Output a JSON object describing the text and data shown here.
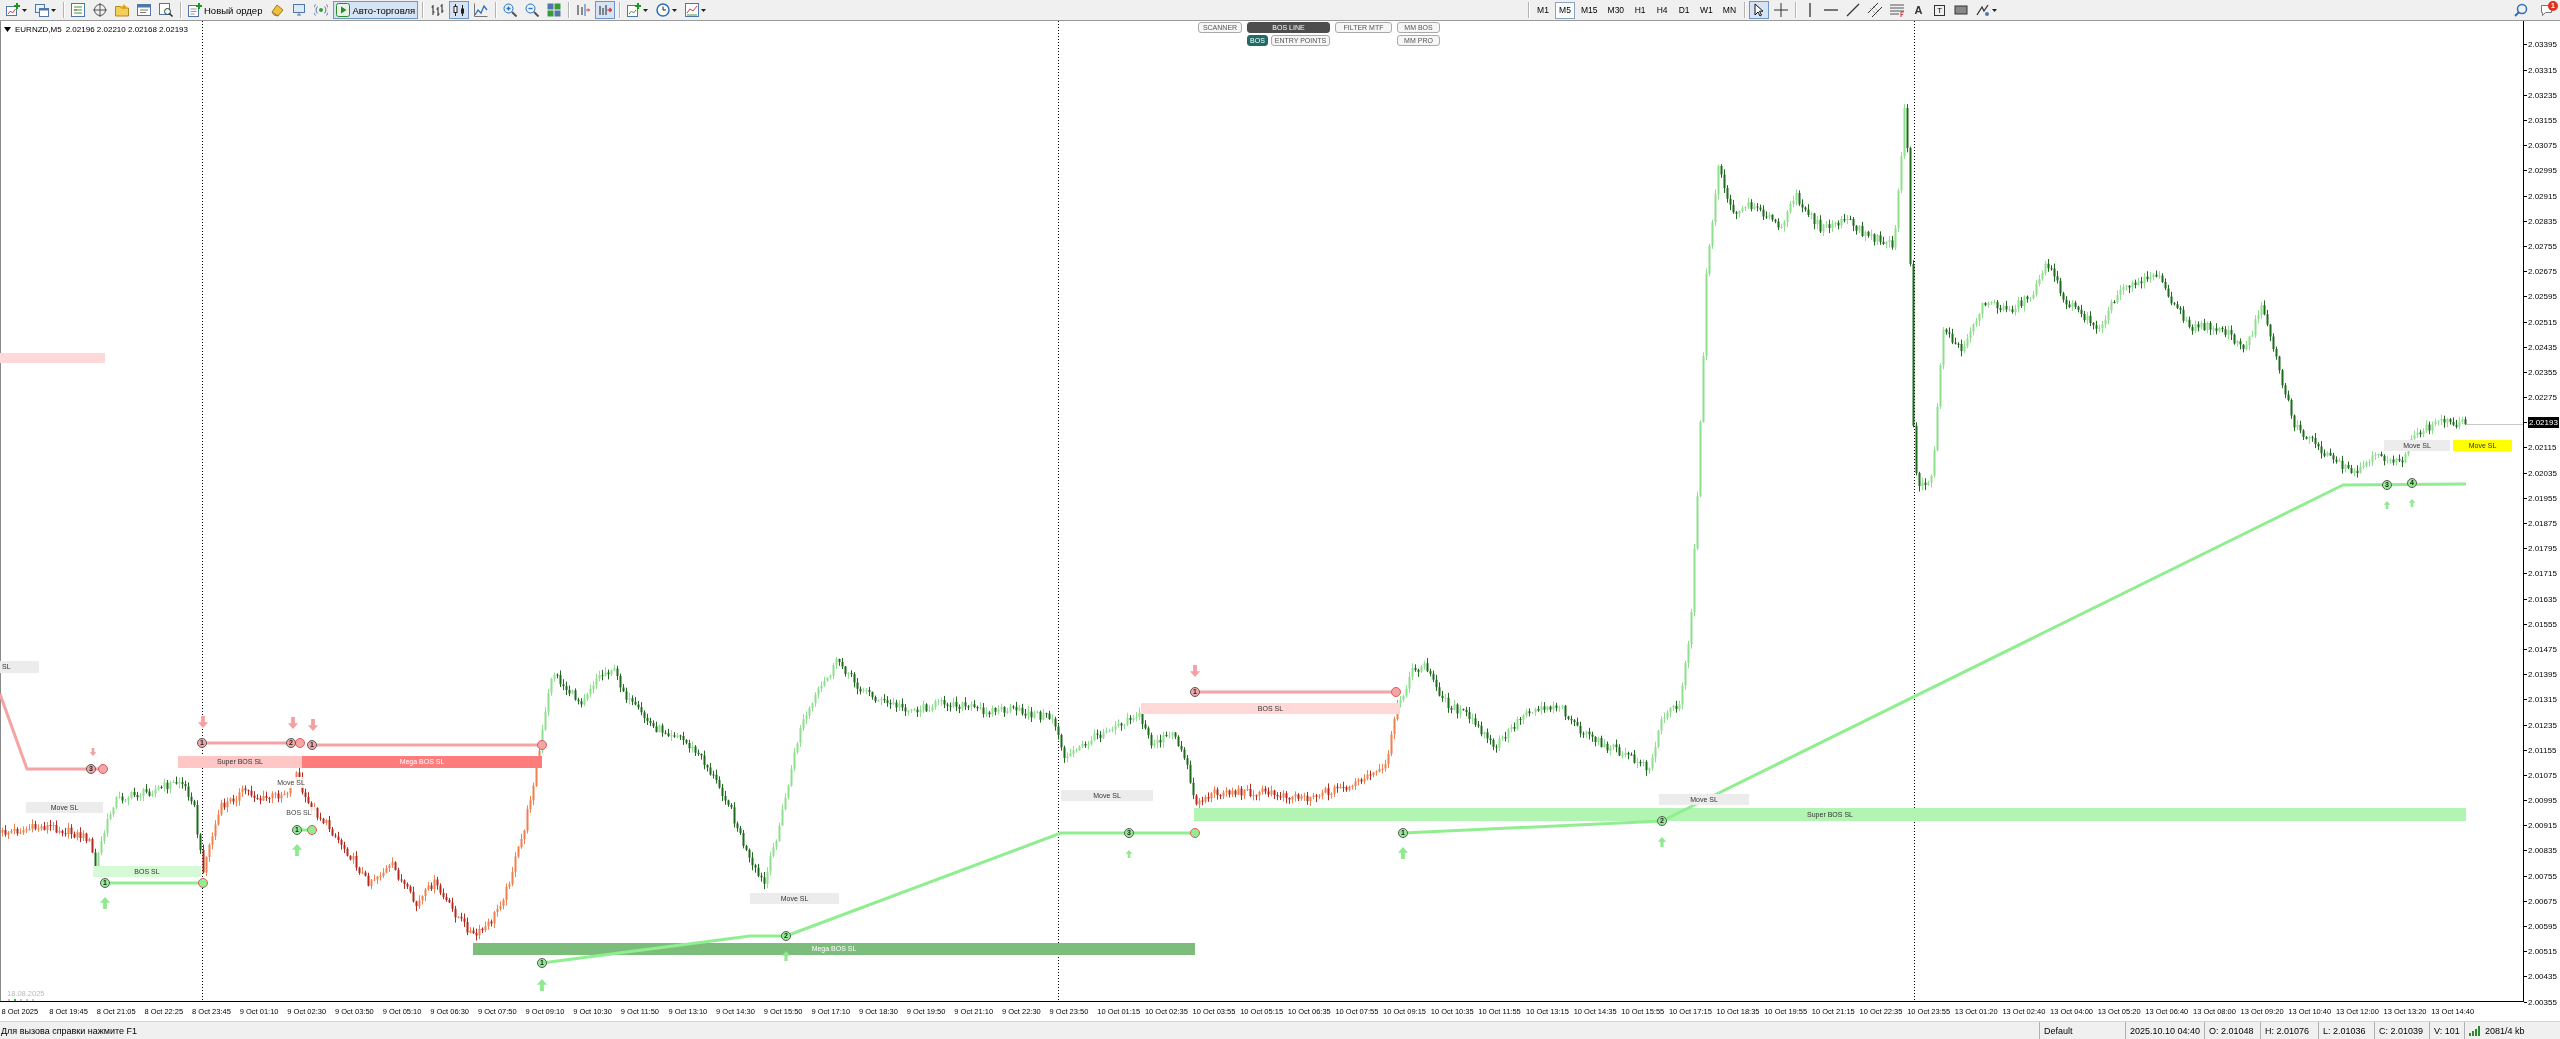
{
  "toolbar": {
    "order_button": "Новый ордер",
    "autotrading_button": {
      "label": "Авто-торговля",
      "on": true
    },
    "chart_types": [
      {
        "selected": false
      },
      {
        "selected": true
      },
      {
        "selected": false
      }
    ],
    "view_toggles": [
      {
        "on": false
      },
      {
        "on": true
      }
    ],
    "timeframes": [
      {
        "label": "M1",
        "selected": false
      },
      {
        "label": "M5",
        "selected": true
      },
      {
        "label": "M15",
        "selected": false
      },
      {
        "label": "M30",
        "selected": false
      },
      {
        "label": "H1",
        "selected": false
      },
      {
        "label": "H4",
        "selected": false
      },
      {
        "label": "D1",
        "selected": false
      },
      {
        "label": "W1",
        "selected": false
      },
      {
        "label": "MN",
        "selected": false
      }
    ],
    "pointer_tools": [
      {
        "selected": true
      },
      {
        "selected": false
      }
    ],
    "drawing_tools": [
      {
        "kind": "vertical-line"
      },
      {
        "kind": "horizontal-line"
      },
      {
        "kind": "trendline"
      },
      {
        "kind": "channel"
      },
      {
        "kind": "fibonacci"
      },
      {
        "kind": "text",
        "label": "A"
      },
      {
        "kind": "text-label",
        "label": "T"
      },
      {
        "kind": "rectangle"
      },
      {
        "kind": "shapes"
      }
    ],
    "notification_count": "1"
  },
  "chart": {
    "symbol": "EURNZD,M5",
    "quotes": "2.02196 2.02210 2.02168 2.02193",
    "panel_rows": [
      {
        "color": "#4d4d4d",
        "buttons": [
          {
            "label": "SCANNER",
            "on": false
          },
          {
            "label": "BOS LINE",
            "on": true
          },
          {
            "label": "FILTER MTF",
            "on": false
          },
          {
            "label": "MM BOS",
            "on": false
          }
        ]
      },
      {
        "color": "#1f6b66",
        "buttons": [
          {
            "label": "BOS",
            "on": true
          },
          {
            "label": "ENTRY POINTS",
            "on": false
          },
          {
            "label": "MM PRO",
            "on": false
          }
        ]
      }
    ],
    "zones": [
      {
        "kind": "move",
        "text": "SL"
      },
      {
        "kind": "move",
        "text": "Move SL"
      },
      {
        "kind": "bos-buy",
        "text": "BOS SL"
      },
      {
        "kind": "super-sell",
        "text": "Super BOS SL"
      },
      {
        "kind": "mega-sell",
        "text": "Mega BOS SL"
      },
      {
        "kind": "plain",
        "text": "Move SL"
      },
      {
        "kind": "plain",
        "text": "BOS SL"
      },
      {
        "kind": "move",
        "text": "Move SL"
      },
      {
        "kind": "mega-buy",
        "text": "Mega BOS SL"
      },
      {
        "kind": "bos-sell",
        "text": "BOS SL"
      },
      {
        "kind": "move",
        "text": "Move SL"
      },
      {
        "kind": "super-buy",
        "text": "Super BOS SL"
      },
      {
        "kind": "move",
        "text": "Move SL"
      },
      {
        "kind": "move",
        "text": "Move SL"
      },
      {
        "kind": "highlight",
        "text": "Move SL"
      }
    ],
    "markers": [
      {
        "number": "3",
        "kind": "sell"
      },
      {
        "number": "1",
        "kind": "buy"
      },
      {
        "number": "1",
        "kind": "sell"
      },
      {
        "number": "2",
        "kind": "sell"
      },
      {
        "number": "1",
        "kind": "sell"
      },
      {
        "number": "1",
        "kind": "buy"
      },
      {
        "number": "1",
        "kind": "buy"
      },
      {
        "number": "2",
        "kind": "buy"
      },
      {
        "number": "3",
        "kind": "buy"
      },
      {
        "number": "1",
        "kind": "sell"
      },
      {
        "number": "1",
        "kind": "buy"
      },
      {
        "number": "2",
        "kind": "buy"
      },
      {
        "number": "3",
        "kind": "buy"
      },
      {
        "number": "4",
        "kind": "buy"
      }
    ],
    "corner_date": "18.08.2025"
  },
  "price_axis": [
    {
      "kind": "tick",
      "text": "2.03395"
    },
    {
      "kind": "tick",
      "text": "2.03315"
    },
    {
      "kind": "tick",
      "text": "2.03235"
    },
    {
      "kind": "tick",
      "text": "2.03155"
    },
    {
      "kind": "tick",
      "text": "2.03075"
    },
    {
      "kind": "tick",
      "text": "2.02995"
    },
    {
      "kind": "tick",
      "text": "2.02915"
    },
    {
      "kind": "tick",
      "text": "2.02835"
    },
    {
      "kind": "tick",
      "text": "2.02755"
    },
    {
      "kind": "tick",
      "text": "2.02675"
    },
    {
      "kind": "tick",
      "text": "2.02595"
    },
    {
      "kind": "tick",
      "text": "2.02515"
    },
    {
      "kind": "tick",
      "text": "2.02435"
    },
    {
      "kind": "tick",
      "text": "2.02355"
    },
    {
      "kind": "tick",
      "text": "2.02275"
    },
    {
      "kind": "current",
      "text": "2.02193"
    },
    {
      "kind": "tick",
      "text": "2.02115"
    },
    {
      "kind": "tick",
      "text": "2.02035"
    },
    {
      "kind": "tick",
      "text": "2.01955"
    },
    {
      "kind": "tick",
      "text": "2.01875"
    },
    {
      "kind": "tick",
      "text": "2.01795"
    },
    {
      "kind": "tick",
      "text": "2.01715"
    },
    {
      "kind": "tick",
      "text": "2.01635"
    },
    {
      "kind": "tick",
      "text": "2.01555"
    },
    {
      "kind": "tick",
      "text": "2.01475"
    },
    {
      "kind": "tick",
      "text": "2.01395"
    },
    {
      "kind": "tick",
      "text": "2.01315"
    },
    {
      "kind": "tick",
      "text": "2.01235"
    },
    {
      "kind": "tick",
      "text": "2.01155"
    },
    {
      "kind": "tick",
      "text": "2.01075"
    },
    {
      "kind": "tick",
      "text": "2.00995"
    },
    {
      "kind": "tick",
      "text": "2.00915"
    },
    {
      "kind": "tick",
      "text": "2.00835"
    },
    {
      "kind": "tick",
      "text": "2.00755"
    },
    {
      "kind": "tick",
      "text": "2.00675"
    },
    {
      "kind": "tick",
      "text": "2.00595"
    },
    {
      "kind": "tick",
      "text": "2.00515"
    },
    {
      "kind": "tick",
      "text": "2.00435"
    },
    {
      "kind": "tick",
      "text": "2.00355"
    }
  ],
  "time_axis": [
    "8 Oct 2025",
    "8 Oct 19:45",
    "8 Oct 21:05",
    "8 Oct 22:25",
    "8 Oct 23:45",
    "9 Oct 01:10",
    "9 Oct 02:30",
    "9 Oct 03:50",
    "9 Oct 05:10",
    "9 Oct 06:30",
    "9 Oct 07:50",
    "9 Oct 09:10",
    "9 Oct 10:30",
    "9 Oct 11:50",
    "9 Oct 13:10",
    "9 Oct 14:30",
    "9 Oct 15:50",
    "9 Oct 17:10",
    "9 Oct 18:30",
    "9 Oct 19:50",
    "9 Oct 21:10",
    "9 Oct 22:30",
    "9 Oct 23:50",
    "10 Oct 01:15",
    "10 Oct 02:35",
    "10 Oct 03:55",
    "10 Oct 05:15",
    "10 Oct 06:35",
    "10 Oct 07:55",
    "10 Oct 09:15",
    "10 Oct 10:35",
    "10 Oct 11:55",
    "10 Oct 13:15",
    "10 Oct 14:35",
    "10 Oct 15:55",
    "10 Oct 17:15",
    "10 Oct 18:35",
    "10 Oct 19:55",
    "10 Oct 21:15",
    "10 Oct 22:35",
    "10 Oct 23:55",
    "13 Oct 01:20",
    "13 Oct 02:40",
    "13 Oct 04:00",
    "13 Oct 05:20",
    "13 Oct 06:40",
    "13 Oct 08:00",
    "13 Oct 09:20",
    "13 Oct 10:40",
    "13 Oct 12:00",
    "13 Oct 13:20",
    "13 Oct 14:40"
  ],
  "status_bar": {
    "help": "Для вызова справки нажмите F1",
    "fields": [
      "Default",
      "2025.10.10 04:40",
      "O: 2.01048",
      "H: 2.01076",
      "L: 2.01036",
      "C: 2.01039",
      "V: 101"
    ],
    "traffic": "2081/4 kb"
  }
}
